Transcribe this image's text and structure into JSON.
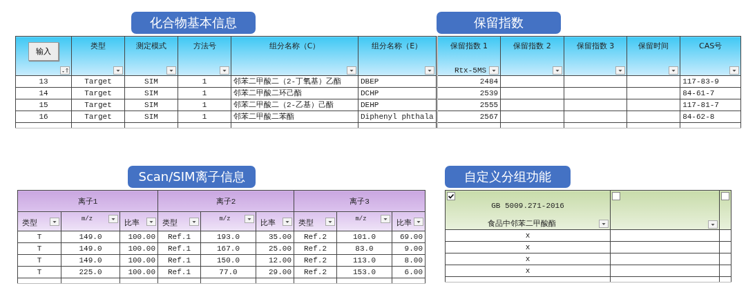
{
  "compound_info": {
    "title": "化合物基本信息",
    "import_button": "输入",
    "columns": [
      {
        "kind": "sort"
      },
      {
        "kind": "dropdown",
        "label": "类型"
      },
      {
        "kind": "dropdown",
        "label": "测定模式"
      },
      {
        "kind": "dropdown",
        "label": "方法号"
      },
      {
        "kind": "dropdown",
        "label": "组分名称（C）"
      },
      {
        "kind": "dropdown",
        "label": "组分名称（E）"
      }
    ],
    "rows": [
      [
        "13",
        "Target",
        "SIM",
        "1",
        "邻苯二甲酸二（2-丁氧基）乙酯",
        "DBEP"
      ],
      [
        "14",
        "Target",
        "SIM",
        "1",
        "邻苯二甲酸二环己酯",
        "DCHP"
      ],
      [
        "15",
        "Target",
        "SIM",
        "1",
        "邻苯二甲酸二（2-乙基）己酯",
        "DEHP"
      ],
      [
        "16",
        "Target",
        "SIM",
        "1",
        "邻苯二甲酸二苯酯",
        "Diphenyl phthala"
      ]
    ]
  },
  "retention_index": {
    "title": "保留指数",
    "columns": [
      {
        "label": "保留指数 1",
        "sub": "Rtx-5MS"
      },
      {
        "label": "保留指数 2"
      },
      {
        "label": "保留指数 3"
      },
      {
        "label": "保留时间"
      },
      {
        "label": "CAS号"
      }
    ],
    "rows": [
      {
        "index_1": "2484",
        "cas": "117-83-9"
      },
      {
        "index_1": "2539",
        "cas": "84-61-7"
      },
      {
        "index_1": "2555",
        "cas": "117-81-7"
      },
      {
        "index_1": "2567",
        "cas": "84-62-8"
      }
    ]
  },
  "ion_info": {
    "title": "Scan/SIM离子信息",
    "groups": [
      {
        "label": "离子1",
        "columns": [
          "类型",
          "m/z",
          "比率"
        ]
      },
      {
        "label": "离子2",
        "columns": [
          "类型",
          "m/z",
          "比率"
        ]
      },
      {
        "label": "离子3",
        "columns": [
          "类型",
          "m/z",
          "比率"
        ]
      }
    ],
    "rows": [
      [
        "T",
        "149.0",
        "100.00",
        "Ref.1",
        "193.0",
        "35.00",
        "Ref.2",
        "101.0",
        "69.00"
      ],
      [
        "T",
        "149.0",
        "100.00",
        "Ref.1",
        "167.0",
        "25.00",
        "Ref.2",
        "83.0",
        "9.00"
      ],
      [
        "T",
        "149.0",
        "100.00",
        "Ref.1",
        "150.0",
        "12.00",
        "Ref.2",
        "113.0",
        "8.00"
      ],
      [
        "T",
        "225.0",
        "100.00",
        "Ref.1",
        "77.0",
        "29.00",
        "Ref.2",
        "153.0",
        "6.00"
      ]
    ]
  },
  "custom_groups": {
    "title": "自定义分组功能",
    "columns": [
      {
        "checked": true,
        "label": "GB 5009.271-2016",
        "sub": "食品中邻苯二甲酸酯"
      },
      {
        "checked": false
      },
      {
        "checked": false
      }
    ],
    "rows": [
      [
        "x"
      ],
      [
        "x"
      ],
      [
        "x"
      ],
      [
        "x"
      ]
    ]
  }
}
